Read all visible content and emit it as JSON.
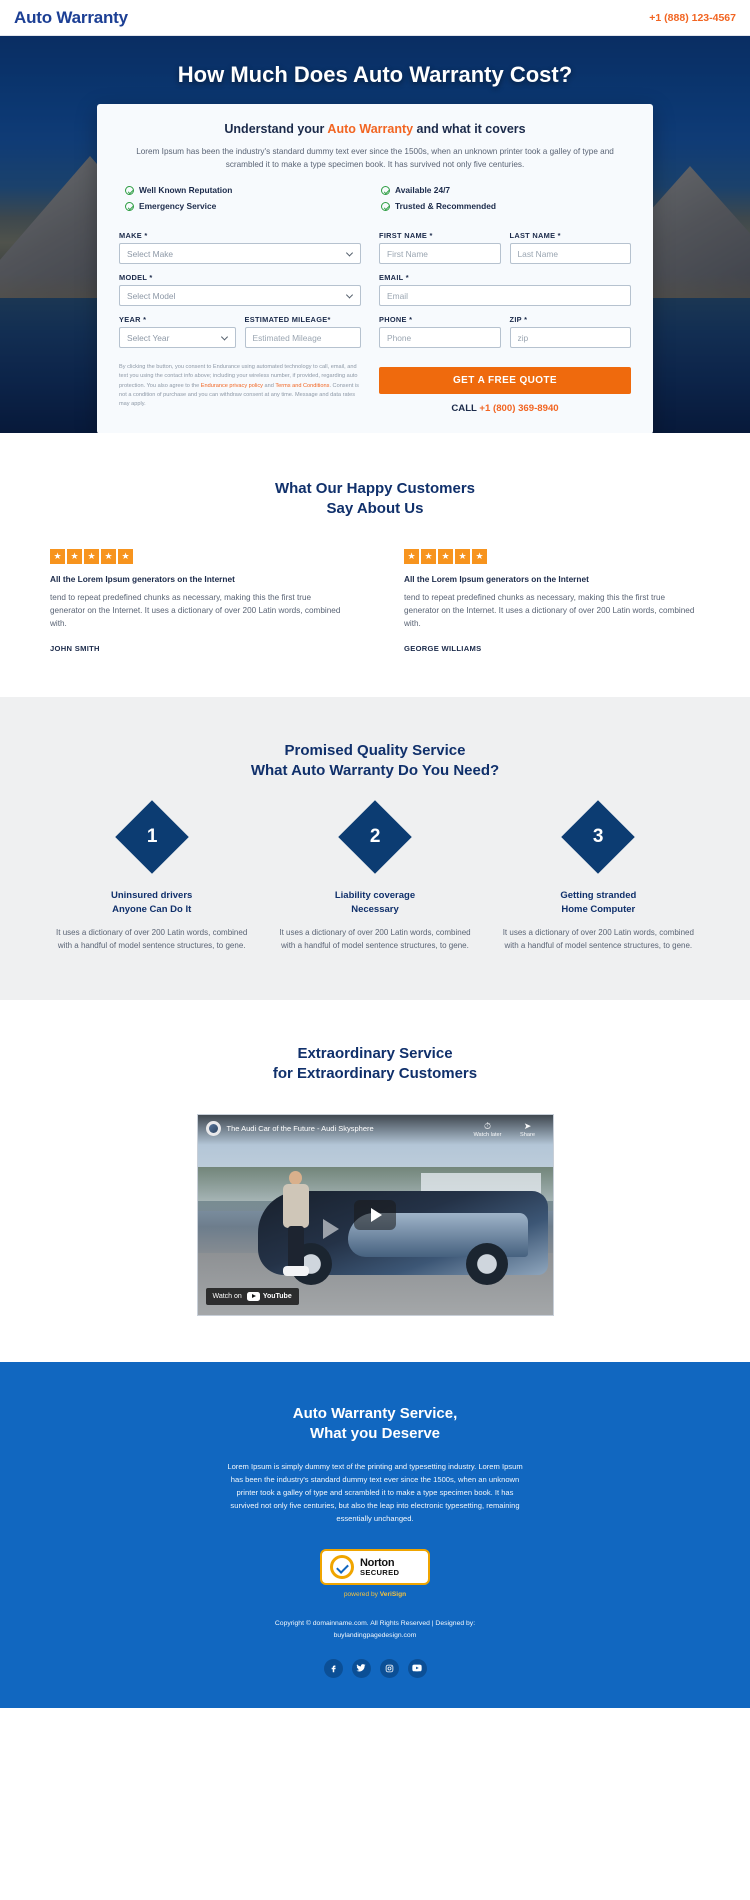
{
  "header": {
    "logo": "Auto Warranty",
    "phone": "+1 (888) 123-4567"
  },
  "hero": {
    "title": "How Much Does Auto Warranty Cost?",
    "card_heading_pre": "Understand your ",
    "card_heading_accent": "Auto Warranty",
    "card_heading_post": " and what it covers",
    "intro": "Lorem Ipsum has been the industry's standard dummy text ever since the 1500s, when an unknown printer took a galley of type and scrambled it to make a type specimen book. It has survived not only five centuries.",
    "features": [
      "Well Known Reputation",
      "Emergency Service",
      "Available 24/7",
      "Trusted & Recommended"
    ],
    "form": {
      "make": {
        "label": "MAKE *",
        "value": "Select Make"
      },
      "model": {
        "label": "MODEL *",
        "value": "Select Model"
      },
      "year": {
        "label": "YEAR *",
        "value": "Select Year"
      },
      "mileage": {
        "label": "ESTIMATED MILEAGE*",
        "placeholder": "Estimated Mileage",
        "value": ""
      },
      "first_name": {
        "label": "FIRST NAME *",
        "placeholder": "First Name",
        "value": ""
      },
      "last_name": {
        "label": "LAST NAME *",
        "placeholder": "Last Name",
        "value": ""
      },
      "email": {
        "label": "EMAIL *",
        "placeholder": "Email",
        "value": ""
      },
      "phone": {
        "label": "PHONE *",
        "placeholder": "Phone",
        "value": ""
      },
      "zip": {
        "label": "ZIP *",
        "placeholder": "zip",
        "value": ""
      }
    },
    "disclaimer": {
      "part1": "By clicking the button, you consent to Endurance using automated technology to call, email, and text you using the contact info above; including your wireless number, if provided, regarding auto protection. You also agree to the ",
      "link1": "Endurance privacy policy",
      "mid": " and ",
      "link2": "Terms and Conditions",
      "part2": ". Consent is not a condition of purchase and you can withdraw consent at any time. Message and data rates may apply."
    },
    "cta_label": "GET A FREE QUOTE",
    "call_prefix": "CALL ",
    "call_number": "+1 (800) 369-8940"
  },
  "testimonials": {
    "title_line1": "What Our Happy Customers",
    "title_line2": "Say About Us",
    "star_glyph": "★",
    "star_count": 5,
    "items": [
      {
        "headline": "All the Lorem Ipsum generators on the Internet",
        "body": "tend to repeat predefined chunks as necessary, making this the first true generator on the Internet. It uses a dictionary of over 200 Latin words, combined with.",
        "author": "JOHN SMITH"
      },
      {
        "headline": "All the Lorem Ipsum generators on the Internet",
        "body": "tend to repeat predefined chunks as necessary, making this the first true generator on the Internet. It uses a dictionary of over 200 Latin words, combined with.",
        "author": "GEORGE WILLIAMS"
      }
    ]
  },
  "quality": {
    "title_line1": "Promised Quality Service",
    "title_line2": "What Auto Warranty Do You Need?",
    "items": [
      {
        "number": "1",
        "title_line1": "Uninsured drivers",
        "title_line2": "Anyone Can Do It",
        "body": "It uses a dictionary of over 200 Latin words, combined with a handful of model sentence structures, to gene."
      },
      {
        "number": "2",
        "title_line1": "Liability coverage",
        "title_line2": "Necessary",
        "body": "It uses a dictionary of over 200 Latin words, combined with a handful of model sentence structures, to gene."
      },
      {
        "number": "3",
        "title_line1": "Getting stranded",
        "title_line2": "Home Computer",
        "body": "It uses a dictionary of over 200 Latin words, combined with a handful of model sentence structures, to gene."
      }
    ]
  },
  "video": {
    "title_line1": "Extraordinary Service",
    "title_line2": "for Extraordinary Customers",
    "player_title": "The Audi Car of the Future - Audi Skysphere",
    "watch_later": "Watch later",
    "share": "Share",
    "watch_on": "Watch on",
    "youtube": "YouTube"
  },
  "footer": {
    "title_line1": "Auto Warranty Service,",
    "title_line2": "What you Deserve",
    "body": "Lorem Ipsum is simply dummy text of the printing and typesetting industry. Lorem Ipsum has been the industry's standard dummy text ever since the 1500s, when an unknown printer took a galley of type and scrambled it to make a type specimen book. It has survived not only five centuries, but also the leap into electronic typesetting, remaining essentially unchanged.",
    "norton_line1": "Norton",
    "norton_line2": "SECURED",
    "powered_pre": "powered by ",
    "powered_brand": "VeriSign",
    "copyright_line1": "Copyright © domainname.com. All Rights Reserved | Designed by:",
    "copyright_line2": "buylandingpagedesign.com",
    "socials": [
      "facebook-icon",
      "twitter-icon",
      "instagram-icon",
      "youtube-icon"
    ]
  },
  "colors": {
    "brand_blue": "#1c3f94",
    "accent_orange": "#f26522",
    "cta_orange": "#ef6a0d",
    "deep_blue": "#10306b",
    "footer_blue": "#1167c0",
    "star_orange": "#f7941e",
    "check_green": "#2f9e44"
  }
}
